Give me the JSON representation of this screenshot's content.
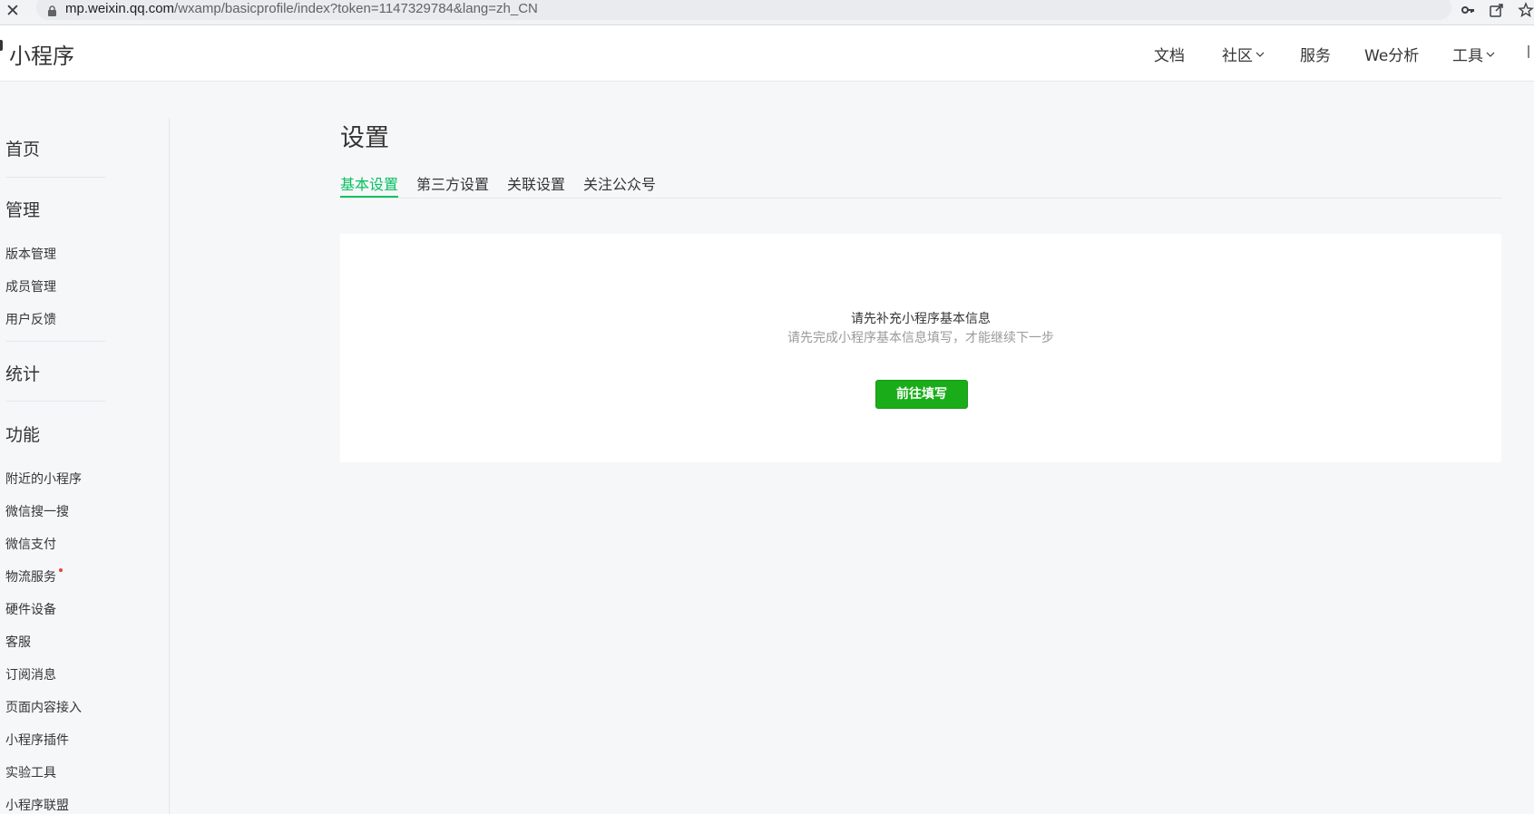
{
  "browser": {
    "url_host": "mp.weixin.qq.com",
    "url_path": "/wxamp/basicprofile/index?token=1147329784&lang=zh_CN",
    "icons": [
      "close-icon",
      "lock-icon",
      "key-icon",
      "share-icon",
      "star-icon"
    ]
  },
  "header": {
    "brand": "小程序",
    "nav": [
      {
        "label": "文档",
        "dropdown": false
      },
      {
        "label": "社区",
        "dropdown": true
      },
      {
        "label": "服务",
        "dropdown": false
      },
      {
        "label": "We分析",
        "dropdown": false
      },
      {
        "label": "工具",
        "dropdown": true
      }
    ]
  },
  "sidebar": {
    "home": "首页",
    "manage": {
      "title": "管理",
      "items": [
        "版本管理",
        "成员管理",
        "用户反馈"
      ]
    },
    "stats": "统计",
    "features": {
      "title": "功能",
      "items": [
        "附近的小程序",
        "微信搜一搜",
        "微信支付",
        "物流服务",
        "硬件设备",
        "客服",
        "订阅消息",
        "页面内容接入",
        "小程序插件",
        "实验工具",
        "小程序联盟"
      ],
      "badge_item": "物流服务"
    }
  },
  "main": {
    "title": "设置",
    "tabs": [
      {
        "label": "基本设置",
        "active": true
      },
      {
        "label": "第三方设置",
        "active": false
      },
      {
        "label": "关联设置",
        "active": false
      },
      {
        "label": "关注公众号",
        "active": false
      }
    ],
    "card": {
      "title": "请先补充小程序基本信息",
      "description": "请先完成小程序基本信息填写，才能继续下一步",
      "button": "前往填写"
    }
  },
  "colors": {
    "accent": "#07c160",
    "button": "#1aad19",
    "badge": "#e64340",
    "background": "#f6f7f9"
  }
}
